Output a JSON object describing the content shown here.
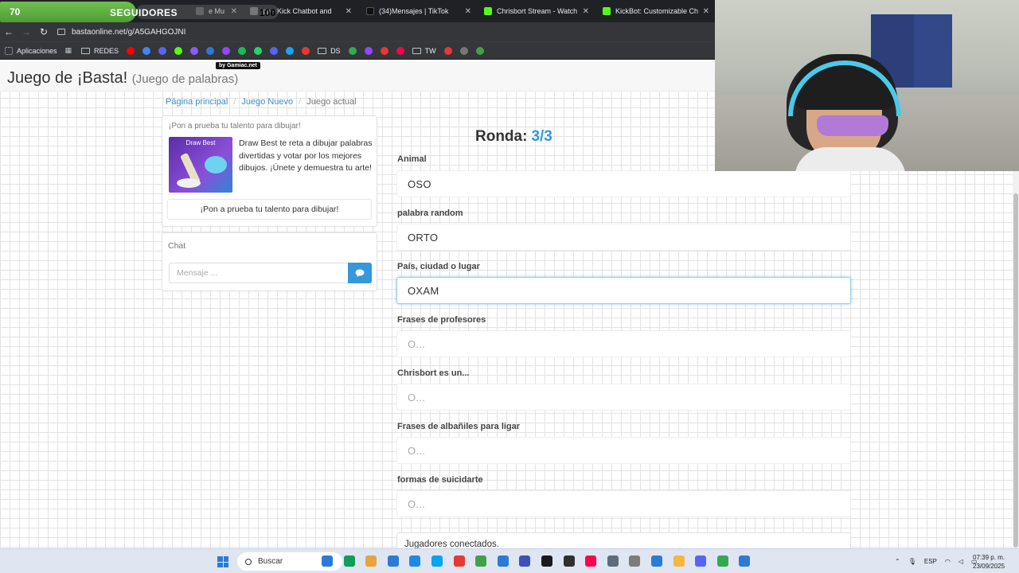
{
  "overlay": {
    "min": "70",
    "label": "SEGUIDORES",
    "max": "100",
    "progress": 0.7
  },
  "tabs": [
    {
      "title": "e Mu",
      "color": "#5a5a5a"
    },
    {
      "title": "pp - Kick Chatbot and",
      "color": "#777777"
    },
    {
      "title": "(34)Mensajes | TikTok",
      "color": "#111111"
    },
    {
      "title": "Chrisbort Stream - Watch Live o",
      "color": "#53fc18"
    },
    {
      "title": "KickBot: Customizable Chat Bot",
      "color": "#53fc18"
    }
  ],
  "address": {
    "url": "bastaonline.net/g/A5GAHGOJNI"
  },
  "bookmarks": {
    "apps": "Aplicaciones",
    "redes": "REDES",
    "ds": "DS",
    "tw": "TW",
    "icon_colors": [
      "#ff0000",
      "#4285f4",
      "#5865f2",
      "#53fc18",
      "#8a5cf6",
      "#2b7bd6",
      "#9146ff",
      "#1db954",
      "#25d366",
      "#5865f2",
      "#1da1f2",
      "#e53935",
      "#34a853",
      "#9146ff",
      "#e53935",
      "#ff0050",
      "#e53935",
      "#777777",
      "#43a047"
    ]
  },
  "page": {
    "badge": "by Gamiac.net",
    "title": "Juego de ¡Basta!",
    "subtitle": "(Juego de palabras)",
    "breadcrumb": [
      "Página principal",
      "Juego Nuevo",
      "Juego actual"
    ]
  },
  "promo": {
    "heading": "¡Pon a prueba tu talento para dibujar!",
    "image_label": "Draw Best",
    "text": "Draw Best te reta a dibujar palabras divertidas y votar por los mejores dibujos. ¡Únete y demuestra tu arte!",
    "button": "¡Pon a prueba tu talento para dibujar!"
  },
  "chat": {
    "heading": "Chat",
    "placeholder": "Mensaje ..."
  },
  "round": {
    "label": "Ronda:",
    "value": "3/3"
  },
  "fields": [
    {
      "label": "Animal",
      "value": "OSO",
      "placeholder": false
    },
    {
      "label": "palabra random",
      "value": "ORTO",
      "placeholder": false
    },
    {
      "label": "País, ciudad o lugar",
      "value": "OXAM",
      "placeholder": false
    },
    {
      "label": "Frases de profesores",
      "value": "O...",
      "placeholder": true
    },
    {
      "label": "Chrisbort es un...",
      "value": "O...",
      "placeholder": true
    },
    {
      "label": "Frases de albañiles para ligar",
      "value": "O...",
      "placeholder": true
    },
    {
      "label": "formas de suicidarte",
      "value": "O...",
      "placeholder": true
    }
  ],
  "players": {
    "label": "Jugadores conectados."
  },
  "taskbar": {
    "search": "Buscar",
    "lang": "ESP",
    "time": "07:39 p. m.",
    "date": "23/09/2025",
    "icon_colors": [
      "#2b7bd6",
      "#0f9d58",
      "#e8a33d",
      "#2b7bd6",
      "#1e88e5",
      "#00a4ef",
      "#e53935",
      "#43a047",
      "#2b7bd6",
      "#3f51b5",
      "#1a1a1a",
      "#2f2f2f",
      "#ff0050",
      "#5d6d7e",
      "#7c7c7c",
      "#2b7bd6",
      "#f6b73c",
      "#5865f2",
      "#34a853",
      "#2b7bd6"
    ]
  }
}
